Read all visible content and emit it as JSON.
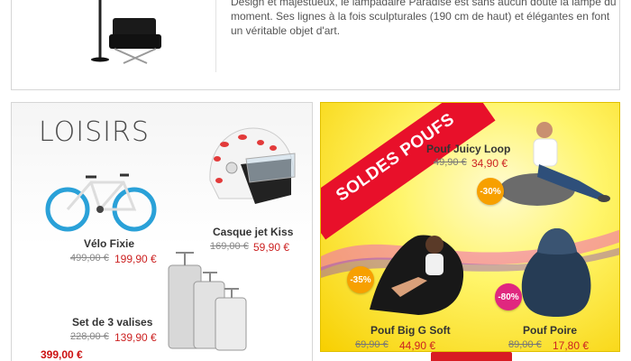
{
  "top": {
    "description": "Design et majestueux, le lampadaire Paradise est sans aucun doute la lampe du moment. Ses lignes à la fois sculpturales (190 cm de haut) et élégantes en font un véritable objet d'art."
  },
  "loisirs": {
    "title": "LOISIRS",
    "products": [
      {
        "name": "Vélo Fixie",
        "old_price": "499,00 €",
        "new_price": "199,90 €"
      },
      {
        "name": "Casque jet Kiss",
        "old_price": "169,00 €",
        "new_price": "59,90 €"
      },
      {
        "name": "Set de 3 valises",
        "old_price": "228,00 €",
        "new_price": "139,90 €"
      }
    ]
  },
  "poufs": {
    "banner": "SOLDES POUFS",
    "products": [
      {
        "name": "Pouf Juicy Loop",
        "old_price": "49,90 €",
        "new_price": "34,90 €",
        "discount": "-30%"
      },
      {
        "name": "Pouf Big G Soft",
        "old_price": "69,90 €",
        "new_price": "44,90 €",
        "discount": "-35%"
      },
      {
        "name": "Pouf Poire",
        "old_price": "89,00 €",
        "new_price": "17,80 €",
        "discount": "-80%"
      }
    ],
    "colors": {
      "red": "#e8102a",
      "yellow": "#fff56a",
      "orange_badge": "#f7a000",
      "pink_badge": "#e0277f"
    }
  },
  "bottom": {
    "price": "399,00 €"
  }
}
